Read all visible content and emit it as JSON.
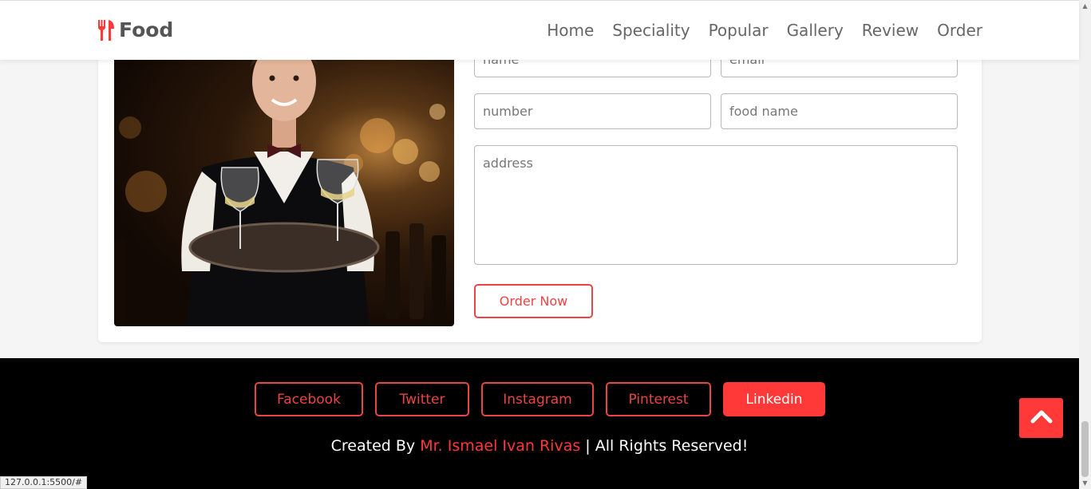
{
  "header": {
    "logo_text": "Food",
    "logo_icon": "utensils-icon",
    "nav": [
      {
        "label": "Home"
      },
      {
        "label": "Speciality"
      },
      {
        "label": "Popular"
      },
      {
        "label": "Gallery"
      },
      {
        "label": "Review"
      },
      {
        "label": "Order"
      }
    ]
  },
  "order_form": {
    "image": "waitress-photo",
    "fields": {
      "name_placeholder": "name",
      "email_placeholder": "email",
      "number_placeholder": "number",
      "food_placeholder": "food name",
      "address_placeholder": "address"
    },
    "submit_label": "Order Now"
  },
  "footer": {
    "social": [
      {
        "label": "Facebook"
      },
      {
        "label": "Twitter"
      },
      {
        "label": "Instagram"
      },
      {
        "label": "Pinterest"
      },
      {
        "label": "Linkedin",
        "active": true
      }
    ],
    "credit_prefix": "Created By",
    "credit_author": "Mr. Ismael Ivan Rivas",
    "credit_suffix": "| All Rights Reserved!"
  },
  "scroll_top_icon": "chevron-up-icon",
  "status_bar_url": "127.0.0.1:5500/#",
  "colors": {
    "accent": "#ff3838",
    "outline_red": "#e84545",
    "footer_bg": "#000000",
    "text_gray": "#666666"
  }
}
